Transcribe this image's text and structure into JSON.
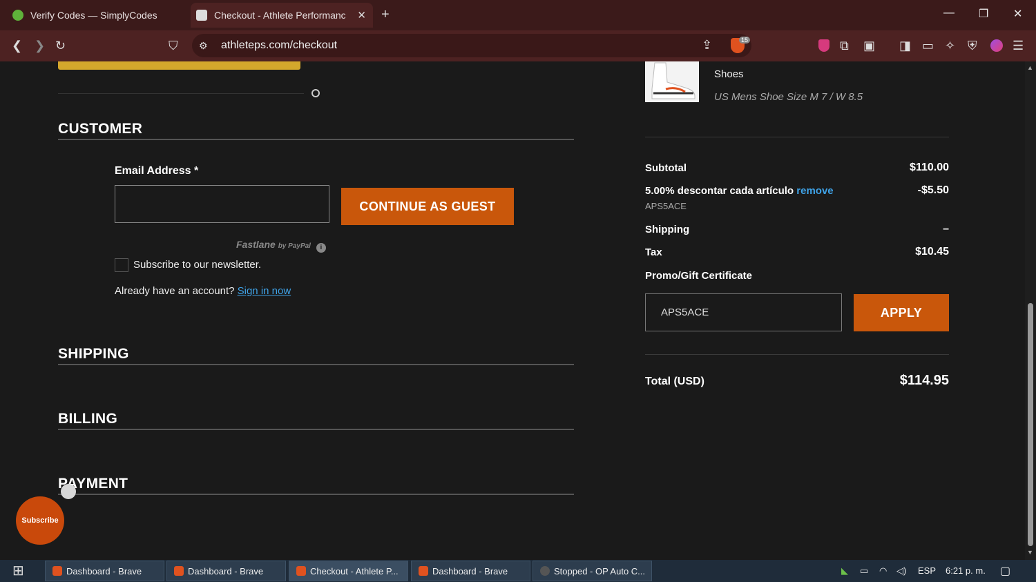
{
  "browser": {
    "tabs": [
      {
        "title": "Verify Codes — SimplyCodes",
        "active": false
      },
      {
        "title": "Checkout - Athlete Performance",
        "active": true
      }
    ],
    "url": "athleteps.com/checkout",
    "shields_count": "15",
    "window_controls": [
      "minimize-icon",
      "restore-icon",
      "close-icon"
    ]
  },
  "checkout": {
    "customer_title": "CUSTOMER",
    "email_label": "Email Address *",
    "email_value": "",
    "continue_label": "CONTINUE AS GUEST",
    "fastlane_brand": "Fastlane",
    "fastlane_by": "by PayPal",
    "newsletter_label": "Subscribe to our newsletter.",
    "account_prompt": "Already have an account?",
    "sign_in_label": "Sign in now",
    "shipping_title": "SHIPPING",
    "billing_title": "BILLING",
    "payment_title": "PAYMENT"
  },
  "summary": {
    "product_name": "Shoes",
    "product_size": "US Mens Shoe Size M 7 / W 8.5",
    "subtotal_label": "Subtotal",
    "subtotal_value": "$110.00",
    "discount_label": "5.00% descontar cada artículo",
    "discount_remove": "remove",
    "discount_value": "-$5.50",
    "discount_code": "APS5ACE",
    "shipping_label": "Shipping",
    "shipping_value": "–",
    "tax_label": "Tax",
    "tax_value": "$10.45",
    "promo_label": "Promo/Gift Certificate",
    "promo_value": "APS5ACE",
    "apply_label": "APPLY",
    "total_label": "Total (USD)",
    "total_value": "$114.95"
  },
  "widget": {
    "subscribe_label": "Subscribe"
  },
  "taskbar": {
    "items": [
      {
        "label": "Dashboard - Brave",
        "active": false
      },
      {
        "label": "Dashboard - Brave",
        "active": false
      },
      {
        "label": "Checkout - Athlete P...",
        "active": true
      },
      {
        "label": "Dashboard - Brave",
        "active": false
      },
      {
        "label": "Stopped - OP Auto C...",
        "active": false
      }
    ],
    "language": "ESP",
    "time": "6:21 p. m."
  },
  "colors": {
    "accent_orange": "#c9570b",
    "link_blue": "#3fa3e8",
    "chrome_bg": "#4d2222"
  }
}
